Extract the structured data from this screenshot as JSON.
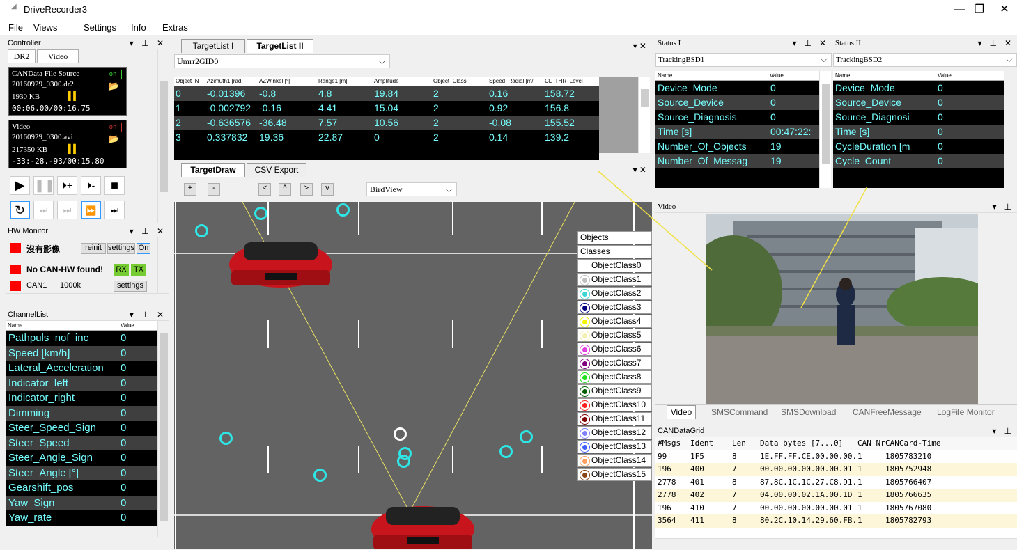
{
  "app": {
    "title": "DriveRecorder3"
  },
  "menu": [
    "File",
    "Views",
    "Settings",
    "Info",
    "Extras"
  ],
  "controller": {
    "title": "Controller",
    "tabs": [
      "DR2",
      "Video"
    ],
    "can_source": {
      "label": "CANData File Source",
      "state": "on",
      "file": "20160929_0300.dr2",
      "size": "1930 KB",
      "time": "00:06.00/00:16.75"
    },
    "video_source": {
      "label": "Video",
      "state": "on",
      "file": "20160929_0300.avi",
      "size": "217350 KB",
      "time": "-33:-28.-93/00:15.80"
    }
  },
  "hw_monitor": {
    "title": "HW Monitor",
    "row1": {
      "label": "沒有影像",
      "btn1": "reinit",
      "btn2": "settings",
      "btn3": "On"
    },
    "row2": {
      "label": "No CAN-HW found!",
      "btn1": "RX",
      "btn2": "TX"
    },
    "row3": {
      "label": "CAN1",
      "rate": "1000k",
      "btn": "settings"
    }
  },
  "channel_list": {
    "title": "ChannelList",
    "col_name": "Name",
    "col_value": "Value",
    "rows": [
      {
        "name": "Pathpuls_nof_inc",
        "value": "0"
      },
      {
        "name": "Speed [km/h]",
        "value": "0"
      },
      {
        "name": "Lateral_Acceleration",
        "value": "0"
      },
      {
        "name": "Indicator_left",
        "value": "0"
      },
      {
        "name": "Indicator_right",
        "value": "0"
      },
      {
        "name": "Dimming",
        "value": "0"
      },
      {
        "name": "Steer_Speed_Sign",
        "value": "0"
      },
      {
        "name": "Steer_Speed",
        "value": "0"
      },
      {
        "name": "Steer_Angle_Sign",
        "value": "0"
      },
      {
        "name": "Steer_Angle [°]",
        "value": "0"
      },
      {
        "name": "Gearshift_pos",
        "value": "0"
      },
      {
        "name": "Yaw_Sign",
        "value": "0"
      },
      {
        "name": "Yaw_rate",
        "value": "0"
      }
    ]
  },
  "targetlist": {
    "tabs": [
      "TargetList I",
      "TargetList II"
    ],
    "dropdown": "Umrr2GID0",
    "headers": [
      "Object_N",
      "Azimuth1 [rad]",
      "AZWinkel [°]",
      "Range1 [m]",
      "Amplitude",
      "Object_Class",
      "Speed_Radial [m/",
      "CL_THR_Level"
    ],
    "rows": [
      [
        "0",
        "-0.01396",
        "-0.8",
        "4.8",
        "19.84",
        "2",
        "0.16",
        "158.72"
      ],
      [
        "1",
        "-0.002792",
        "-0.16",
        "4.41",
        "15.04",
        "2",
        "0.92",
        "156.8"
      ],
      [
        "2",
        "-0.636576",
        "-36.48",
        "7.57",
        "10.56",
        "2",
        "-0.08",
        "155.52"
      ],
      [
        "3",
        "0.337832",
        "19.36",
        "22.87",
        "0",
        "2",
        "0.14",
        "139.2"
      ]
    ]
  },
  "targetdraw": {
    "tabs": [
      "TargetDraw",
      "CSV Export"
    ],
    "buttons": [
      "+",
      "-",
      "<",
      "^",
      ">",
      "v"
    ],
    "view": "BirdView",
    "legend_headers": [
      "Objects",
      "Classes"
    ],
    "legend": [
      {
        "label": "ObjectClass0",
        "color": "#ffffff"
      },
      {
        "label": "ObjectClass1",
        "color": "#c0c0c0"
      },
      {
        "label": "ObjectClass2",
        "color": "#3dd6d6"
      },
      {
        "label": "ObjectClass3",
        "color": "#000080"
      },
      {
        "label": "ObjectClass4",
        "color": "#f5f500"
      },
      {
        "label": "ObjectClass5",
        "color": "#f5f0b0"
      },
      {
        "label": "ObjectClass6",
        "color": "#e040e0"
      },
      {
        "label": "ObjectClass7",
        "color": "#800080"
      },
      {
        "label": "ObjectClass8",
        "color": "#20e020"
      },
      {
        "label": "ObjectClass9",
        "color": "#006000"
      },
      {
        "label": "ObjectClass10",
        "color": "#ff2020"
      },
      {
        "label": "ObjectClass11",
        "color": "#800000"
      },
      {
        "label": "ObjectClass12",
        "color": "#8080ff"
      },
      {
        "label": "ObjectClass13",
        "color": "#4060ff"
      },
      {
        "label": "ObjectClass14",
        "color": "#ffa060"
      },
      {
        "label": "ObjectClass15",
        "color": "#8b4513"
      }
    ]
  },
  "status1": {
    "title": "Status I",
    "dropdown": "TrackingBSD1",
    "col_name": "Name",
    "col_value": "Value",
    "rows": [
      {
        "name": "Device_Mode",
        "value": "0"
      },
      {
        "name": "Source_Device",
        "value": "0"
      },
      {
        "name": "Source_Diagnosis",
        "value": "0"
      },
      {
        "name": "Time [s]",
        "value": "00:47:22:"
      },
      {
        "name": "Number_Of_Objects",
        "value": "19"
      },
      {
        "name": "Number_Of_Messag",
        "value": "19"
      }
    ]
  },
  "status2": {
    "title": "Status II",
    "dropdown": "TrackingBSD2",
    "col_name": "Name",
    "col_value": "Value",
    "rows": [
      {
        "name": "Device_Mode",
        "value": "0"
      },
      {
        "name": "Source_Device",
        "value": "0"
      },
      {
        "name": "Source_Diagnosi",
        "value": "0"
      },
      {
        "name": "Time [s]",
        "value": "0"
      },
      {
        "name": "CycleDuration [m",
        "value": "0"
      },
      {
        "name": "Cycle_Count",
        "value": "0"
      }
    ]
  },
  "video": {
    "title": "Video",
    "tabs": [
      "Video",
      "SMSCommand",
      "SMSDownload",
      "CANFreeMessage",
      "LogFile Monitor"
    ]
  },
  "candatagrid": {
    "title": "CANDataGrid",
    "headers": [
      "#Msgs",
      "Ident",
      "Len",
      "Data bytes [7...0]",
      "CAN Nr",
      "CANCard-Time"
    ],
    "rows": [
      [
        "99",
        "1F5",
        "8",
        "1E.FF.FF.CE.00.00.00.",
        "1",
        "1805783210"
      ],
      [
        "196",
        "400",
        "7",
        "00.00.00.00.00.00.01",
        "1",
        "1805752948"
      ],
      [
        "2778",
        "401",
        "8",
        "87.8C.1C.1C.27.C8.D1.",
        "1",
        "1805766407"
      ],
      [
        "2778",
        "402",
        "7",
        "04.00.00.02.1A.00.1D",
        "1",
        "1805766635"
      ],
      [
        "196",
        "410",
        "7",
        "00.00.00.00.00.00.01",
        "1",
        "1805767080"
      ],
      [
        "3564",
        "411",
        "8",
        "80.2C.10.14.29.60.FB.",
        "1",
        "1805782793"
      ]
    ]
  }
}
